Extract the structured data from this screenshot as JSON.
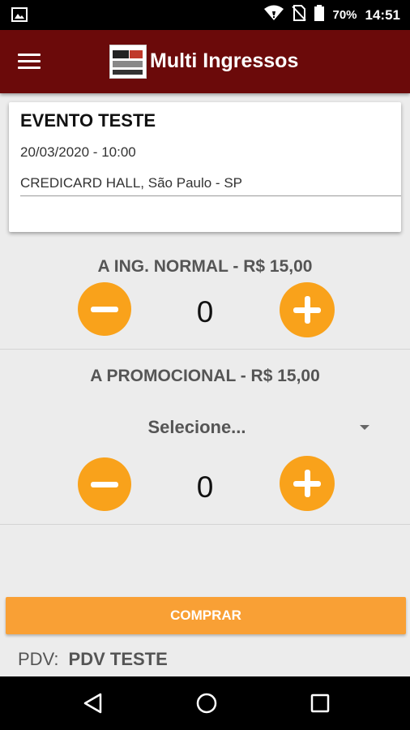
{
  "status_bar": {
    "battery": "70%",
    "time": "14:51"
  },
  "app_bar": {
    "title": "Multi Ingressos"
  },
  "event": {
    "name": "EVENTO TESTE",
    "date": "20/03/2020 - 10:00",
    "venue": "CREDICARD HALL, São Paulo - SP"
  },
  "tickets": [
    {
      "title": "A ING. NORMAL - R$ 15,00",
      "quantity": "0"
    },
    {
      "title": "A PROMOCIONAL - R$ 15,00",
      "select_label": "Selecione...",
      "quantity": "0"
    }
  ],
  "buy_button": "COMPRAR",
  "pdv": {
    "label": "PDV:",
    "value": "PDV TESTE"
  },
  "colors": {
    "app_bar": "#6b0a0a",
    "accent": "#f9a21b",
    "buy_button": "#f9a035",
    "background": "#ececec"
  },
  "icons": [
    "image-icon",
    "wifi-icon",
    "no-sim-icon",
    "battery-icon",
    "menu-icon",
    "minus-icon",
    "plus-icon",
    "dropdown-arrow-icon",
    "back-icon",
    "home-icon",
    "recent-apps-icon"
  ]
}
